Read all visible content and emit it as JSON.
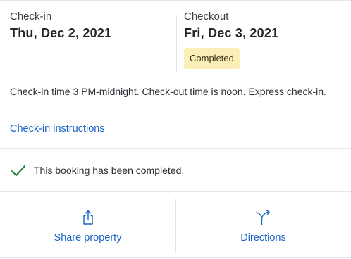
{
  "checkin": {
    "label": "Check-in",
    "date": "Thu, Dec 2, 2021"
  },
  "checkout": {
    "label": "Checkout",
    "date": "Fri, Dec 3, 2021",
    "badge": "Completed"
  },
  "policy_text": "Check-in time 3 PM-midnight. Check-out time is  noon. Express check-in.",
  "instructions_link": "Check-in instructions",
  "status": {
    "icon": "check-icon",
    "text": "This booking has been completed."
  },
  "actions": [
    {
      "icon": "share-icon",
      "label": "Share property"
    },
    {
      "icon": "directions-icon",
      "label": "Directions"
    }
  ],
  "colors": {
    "link": "#1a64c8",
    "badge_bg": "#fbefb7",
    "check": "#2e8540"
  }
}
